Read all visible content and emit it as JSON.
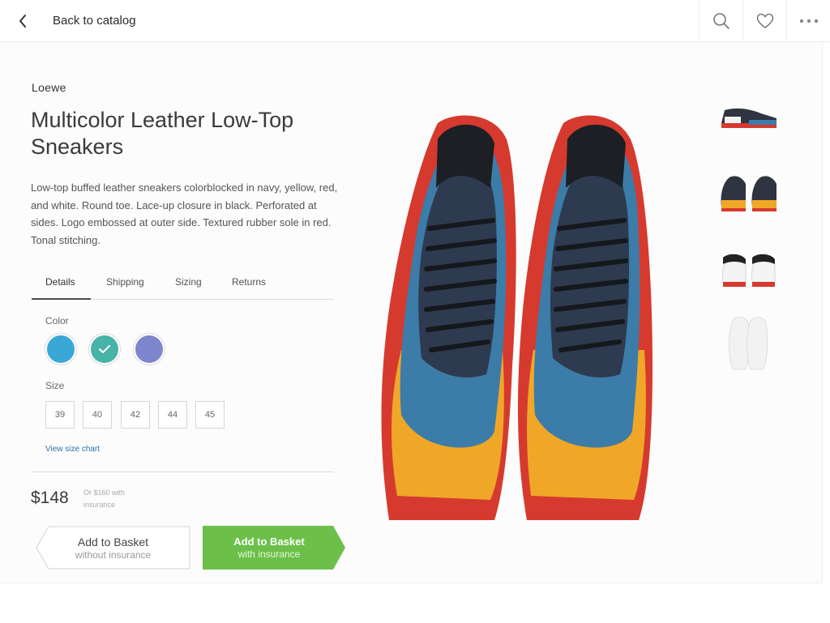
{
  "header": {
    "back_label": "Back to catalog"
  },
  "product": {
    "brand": "Loewe",
    "title": "Multicolor Leather Low-Top Sneakers",
    "description": "Low-top buffed leather sneakers colorblocked in navy, yellow, red, and white. Round toe. Lace-up closure in black. Perforated at sides. Logo embossed at outer side. Textured rubber sole in red. Tonal stitching."
  },
  "tabs": [
    {
      "label": "Details",
      "active": true
    },
    {
      "label": "Shipping",
      "active": false
    },
    {
      "label": "Sizing",
      "active": false
    },
    {
      "label": "Returns",
      "active": false
    }
  ],
  "options": {
    "color_label": "Color",
    "colors": [
      {
        "value": "#3aa8d6",
        "selected": false
      },
      {
        "value": "#48b3a8",
        "selected": true
      },
      {
        "value": "#7d86cc",
        "selected": false
      }
    ],
    "size_label": "Size",
    "sizes": [
      "39",
      "40",
      "42",
      "44",
      "45"
    ],
    "size_chart_link": "View size chart"
  },
  "pricing": {
    "price": "$148",
    "note": "Or $160 with insurance"
  },
  "actions": {
    "basket_plain": {
      "main": "Add to Basket",
      "sub": "without insurance"
    },
    "basket_insured": {
      "main": "Add to Basket",
      "sub": "with insurance"
    }
  },
  "colors": {
    "accent_green": "#6cc04a",
    "link_blue": "#2e6fa6"
  },
  "icons": {
    "back": "chevron-left-icon",
    "search": "search-icon",
    "favorite": "heart-icon",
    "more": "more-dots-icon"
  }
}
